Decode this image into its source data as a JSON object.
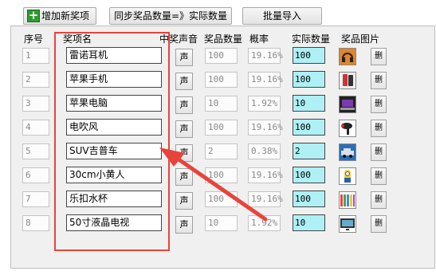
{
  "toolbar": {
    "add_label": "增加新奖项",
    "sync_label": "同步奖品数量=》实际数量",
    "import_label": "批量导入"
  },
  "headers": {
    "index": "序号",
    "name": "奖项名",
    "sound": "中奖声音",
    "count": "奖品数量",
    "prob": "概率",
    "actual": "实际数量",
    "picture": "奖品图片"
  },
  "sound_button_label": "声",
  "delete_button_label": "删",
  "rows": [
    {
      "index": "1",
      "name": "雷诺耳机",
      "count": "100",
      "prob": "19.16%",
      "actual": "100",
      "picture_icon": "headphones-icon"
    },
    {
      "index": "2",
      "name": "苹果手机",
      "count": "100",
      "prob": "19.16%",
      "actual": "100",
      "picture_icon": "phone-icon"
    },
    {
      "index": "3",
      "name": "苹果电脑",
      "count": "10",
      "prob": "1.92%",
      "actual": "10",
      "picture_icon": "laptop-icon"
    },
    {
      "index": "4",
      "name": "电吹风",
      "count": "100",
      "prob": "19.16%",
      "actual": "100",
      "picture_icon": "hairdryer-icon"
    },
    {
      "index": "5",
      "name": "SUV吉普车",
      "count": "2",
      "prob": "0.38%",
      "actual": "2",
      "picture_icon": "car-icon"
    },
    {
      "index": "6",
      "name": "30cm小黄人",
      "count": "100",
      "prob": "19.16%",
      "actual": "100",
      "picture_icon": "minion-icon"
    },
    {
      "index": "7",
      "name": "乐扣水杯",
      "count": "100",
      "prob": "19.16%",
      "actual": "100",
      "picture_icon": "cup-icon"
    },
    {
      "index": "8",
      "name": "50寸液晶电视",
      "count": "10",
      "prob": "1.92%",
      "actual": "10",
      "picture_icon": "tv-icon"
    }
  ],
  "colors": {
    "annotation": "#e8443a",
    "actual_field": "#aef0f6"
  }
}
